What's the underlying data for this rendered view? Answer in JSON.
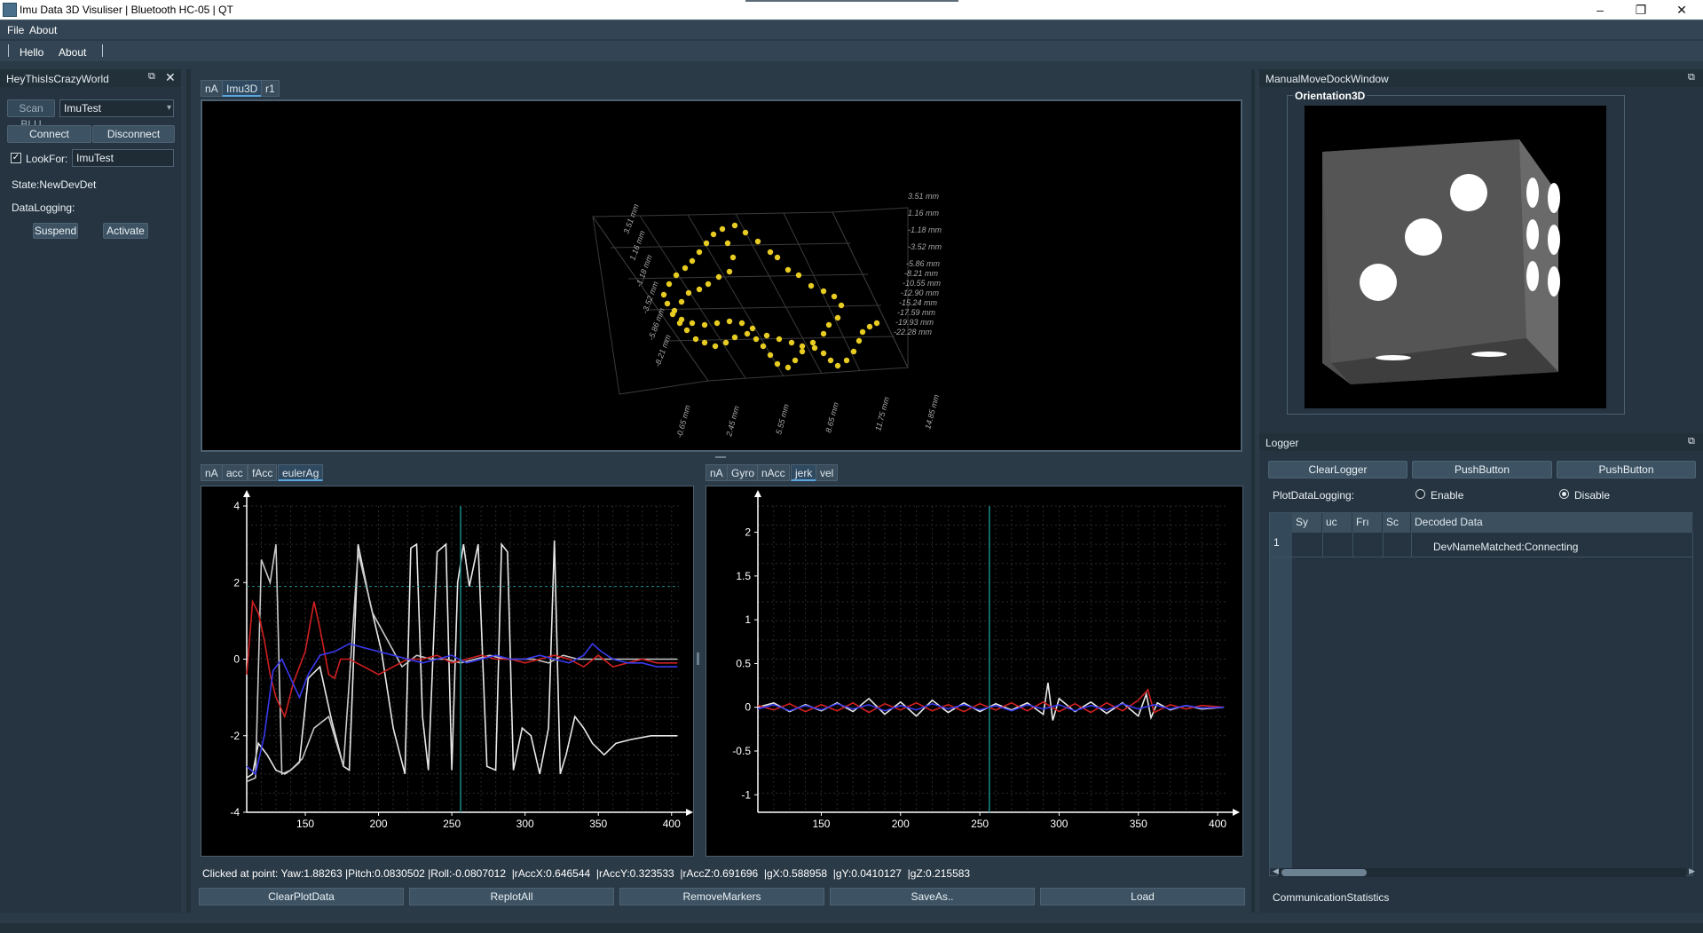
{
  "window": {
    "title": "Imu Data 3D Visuliser | Bluetooth HC-05 | QT"
  },
  "menubar": {
    "file": "File",
    "about": "About"
  },
  "toolbar": {
    "hello": "Hello",
    "about": "About"
  },
  "left_dock": {
    "title": "HeyThisIsCrazyWorld",
    "scan_button": "Scan BLU",
    "device_combo": "ImuTest",
    "connect": "Connect",
    "disconnect": "Disconnect",
    "lookfor_label": "LookFor:",
    "lookfor_value": "ImuTest",
    "state": "State:NewDevDet",
    "datalogging": "DataLogging:",
    "suspend": "Suspend",
    "activate": "Activate"
  },
  "top_tabs": [
    "nA",
    "Imu3D",
    "r1"
  ],
  "scatter3d": {
    "right_axis_labels": [
      "3.51 mm",
      "1.16 mm",
      "-1.18 mm",
      "-3.52 mm",
      "-5.86 mm",
      "-8.21 mm",
      "-10.55 mm",
      "-12.90 mm",
      "-15.24 mm",
      "-17.59 mm",
      "-19.93 mm",
      "-22.28 mm"
    ],
    "left_axis_labels": [
      "3.51 mm",
      "1.16 mm",
      "-1.18 mm",
      "-3.52 mm",
      "-5.86 mm",
      "-8.21 mm"
    ],
    "bottom_axis_labels": [
      "-0.65 mm",
      "2.45 mm",
      "5.55 mm",
      "8.65 mm",
      "11.75 mm",
      "14.85 mm"
    ]
  },
  "plot1_tabs": [
    "nA",
    "acc",
    "fAcc",
    "eulerAg"
  ],
  "plot2_tabs": [
    "nA",
    "Gyro",
    "nAcc",
    "jerk",
    "vel"
  ],
  "chart_data": [
    {
      "type": "line",
      "tab": "eulerAg",
      "x_ticks": [
        "150",
        "200",
        "250",
        "300",
        "350",
        "400"
      ],
      "y_ticks": [
        "4",
        "2",
        "0",
        "-2",
        "-4"
      ],
      "xlim": [
        110,
        405
      ],
      "ylim": [
        -4,
        4
      ],
      "grid": true,
      "crosshair": {
        "x": 256,
        "y": 1.9
      },
      "series": [
        {
          "color": "#e8e8e8",
          "x": [
            110,
            114,
            118,
            124,
            130,
            136,
            140,
            146,
            152,
            160,
            168,
            176,
            180,
            186,
            194,
            202,
            210,
            218,
            222,
            226,
            230,
            234,
            240,
            246,
            250,
            254,
            258,
            262,
            268,
            274,
            280,
            284,
            288,
            292,
            298,
            304,
            310,
            316,
            320,
            324,
            328,
            334,
            340,
            346,
            354,
            362,
            372,
            386,
            404
          ],
          "y": [
            -3.1,
            -3.0,
            -2.2,
            -2.5,
            -2.9,
            -3.0,
            -2.9,
            -2.7,
            -0.5,
            -0.2,
            -1.6,
            -2.8,
            -2.9,
            3.0,
            1.5,
            0.2,
            -1.8,
            -3.0,
            2.9,
            3.0,
            -1.5,
            -2.9,
            2.8,
            3.0,
            -2.9,
            2.0,
            3.0,
            1.9,
            3.0,
            -2.8,
            -2.9,
            3.0,
            2.8,
            -2.9,
            -1.8,
            -2.0,
            -3.0,
            -1.8,
            3.1,
            -3.0,
            -2.5,
            -1.5,
            -1.8,
            -2.2,
            -2.5,
            -2.2,
            -2.1,
            -2.0,
            -2.0
          ]
        },
        {
          "color": "#c8c8c8",
          "x": [
            110,
            116,
            120,
            126,
            130,
            134,
            140,
            148,
            156,
            166,
            176,
            186,
            196,
            206,
            216,
            226,
            236,
            246,
            256,
            266,
            276,
            286,
            296,
            306,
            316,
            326,
            336,
            346,
            356,
            366,
            380,
            404
          ],
          "y": [
            -3.2,
            -3.1,
            2.6,
            2.0,
            3.0,
            -3.0,
            -2.9,
            -2.6,
            -1.8,
            -1.5,
            -2.8,
            2.8,
            1.2,
            0.5,
            -0.2,
            0.1,
            0.0,
            0.0,
            -0.1,
            0.0,
            0.1,
            0.0,
            0.0,
            0.0,
            -0.1,
            0.1,
            0.0,
            0.0,
            0.0,
            0.0,
            0.0,
            0.0
          ]
        },
        {
          "color": "#d02020",
          "x": [
            110,
            114,
            118,
            122,
            126,
            130,
            136,
            142,
            150,
            156,
            160,
            166,
            170,
            174,
            180,
            190,
            200,
            210,
            220,
            230,
            240,
            250,
            260,
            270,
            280,
            290,
            300,
            310,
            320,
            330,
            340,
            350,
            360,
            370,
            380,
            390,
            404
          ],
          "y": [
            -0.4,
            1.5,
            1.2,
            0.5,
            -0.4,
            -1.0,
            -1.5,
            -0.6,
            0.2,
            1.5,
            0.8,
            -0.4,
            -0.5,
            0.0,
            0.0,
            -0.2,
            -0.4,
            -0.2,
            0.0,
            0.0,
            0.1,
            -0.1,
            0.0,
            0.1,
            0.0,
            0.0,
            -0.1,
            0.0,
            0.1,
            0.0,
            -0.2,
            0.1,
            -0.2,
            -0.1,
            0.0,
            -0.1,
            -0.1
          ]
        },
        {
          "color": "#3a3af0",
          "x": [
            110,
            116,
            122,
            128,
            134,
            140,
            146,
            152,
            160,
            170,
            180,
            190,
            200,
            210,
            220,
            230,
            240,
            250,
            260,
            270,
            280,
            290,
            300,
            310,
            320,
            330,
            340,
            346,
            352,
            360,
            370,
            380,
            390,
            404
          ],
          "y": [
            -2.8,
            -3.0,
            -2.0,
            -0.3,
            0.0,
            -0.5,
            -1.0,
            -0.4,
            0.1,
            0.2,
            0.4,
            0.3,
            0.2,
            0.1,
            0.0,
            -0.1,
            0.0,
            0.1,
            -0.1,
            0.0,
            0.1,
            0.0,
            0.0,
            0.1,
            0.0,
            -0.1,
            0.1,
            0.4,
            0.2,
            0.0,
            -0.1,
            -0.1,
            -0.2,
            -0.2
          ]
        }
      ]
    },
    {
      "type": "line",
      "tab": "jerk",
      "x_ticks": [
        "150",
        "200",
        "250",
        "300",
        "350",
        "400"
      ],
      "y_ticks": [
        "2",
        "1.5",
        "1",
        "0.5",
        "0",
        "-0.5",
        "-1"
      ],
      "xlim": [
        110,
        405
      ],
      "ylim": [
        -1.2,
        2.3
      ],
      "grid": true,
      "crosshair": {
        "x": 256
      },
      "series": [
        {
          "color": "#e8e8e8",
          "x": [
            110,
            120,
            130,
            140,
            150,
            160,
            170,
            180,
            190,
            200,
            210,
            220,
            230,
            240,
            250,
            260,
            270,
            280,
            290,
            293,
            296,
            300,
            310,
            320,
            330,
            340,
            350,
            355,
            358,
            362,
            370,
            380,
            390,
            404
          ],
          "y": [
            0.0,
            0.05,
            -0.05,
            0.03,
            -0.04,
            0.05,
            -0.05,
            0.1,
            -0.08,
            0.06,
            -0.1,
            0.08,
            -0.06,
            0.05,
            -0.05,
            0.04,
            -0.03,
            0.05,
            -0.08,
            0.28,
            -0.15,
            0.1,
            -0.05,
            0.06,
            -0.07,
            0.05,
            -0.1,
            0.15,
            -0.12,
            0.05,
            -0.03,
            0.02,
            -0.02,
            0.0
          ]
        },
        {
          "color": "#d02020",
          "x": [
            110,
            120,
            130,
            140,
            150,
            160,
            170,
            180,
            190,
            200,
            210,
            220,
            230,
            240,
            250,
            260,
            270,
            280,
            290,
            300,
            310,
            320,
            330,
            340,
            350,
            356,
            360,
            370,
            380,
            390,
            404
          ],
          "y": [
            0.02,
            -0.03,
            0.04,
            -0.05,
            0.03,
            -0.04,
            0.05,
            -0.06,
            0.04,
            -0.03,
            0.05,
            -0.04,
            0.03,
            -0.05,
            0.04,
            -0.03,
            0.05,
            -0.04,
            0.06,
            -0.05,
            0.04,
            -0.06,
            0.05,
            -0.04,
            0.08,
            0.2,
            -0.06,
            0.03,
            -0.02,
            0.02,
            0.0
          ]
        },
        {
          "color": "#3a3af0",
          "x": [
            110,
            120,
            130,
            140,
            150,
            160,
            170,
            180,
            190,
            200,
            210,
            220,
            230,
            240,
            250,
            260,
            270,
            280,
            290,
            300,
            310,
            320,
            330,
            340,
            350,
            360,
            370,
            380,
            390,
            404
          ],
          "y": [
            -0.02,
            0.03,
            -0.04,
            0.02,
            -0.03,
            0.04,
            -0.02,
            0.03,
            -0.04,
            0.02,
            -0.03,
            0.04,
            -0.02,
            0.03,
            -0.03,
            0.02,
            -0.04,
            0.03,
            -0.02,
            0.03,
            -0.04,
            0.02,
            -0.03,
            0.04,
            -0.02,
            0.03,
            -0.02,
            0.02,
            -0.01,
            0.0
          ]
        }
      ]
    }
  ],
  "status_line": "Clicked at point: Yaw:1.88263 |Pitch:0.0830502 |Roll:-0.0807012  |rAccX:0.646544  |rAccY:0.323533  |rAccZ:0.691696  |gX:0.588958  |gY:0.0410127  |gZ:0.215583",
  "bottom_buttons": [
    "ClearPlotData",
    "ReplotAll",
    "RemoveMarkers",
    "SaveAs..",
    "Load"
  ],
  "right_dock": {
    "title": "ManualMoveDockWindow",
    "group_title": "Orientation3D"
  },
  "logger": {
    "title": "Logger",
    "buttons": [
      "ClearLogger",
      "PushButton",
      "PushButton"
    ],
    "plot_logging_label": "PlotDataLogging:",
    "enable": "Enable",
    "disable": "Disable",
    "selected": "Disable",
    "columns": [
      "Sy",
      "uc",
      "Frı",
      "Sc",
      "Decoded Data"
    ],
    "rows": [
      {
        "num": "1",
        "decoded": "DevNameMatched:Connecting"
      }
    ],
    "comm_stats": "CommunicationStatistics"
  }
}
